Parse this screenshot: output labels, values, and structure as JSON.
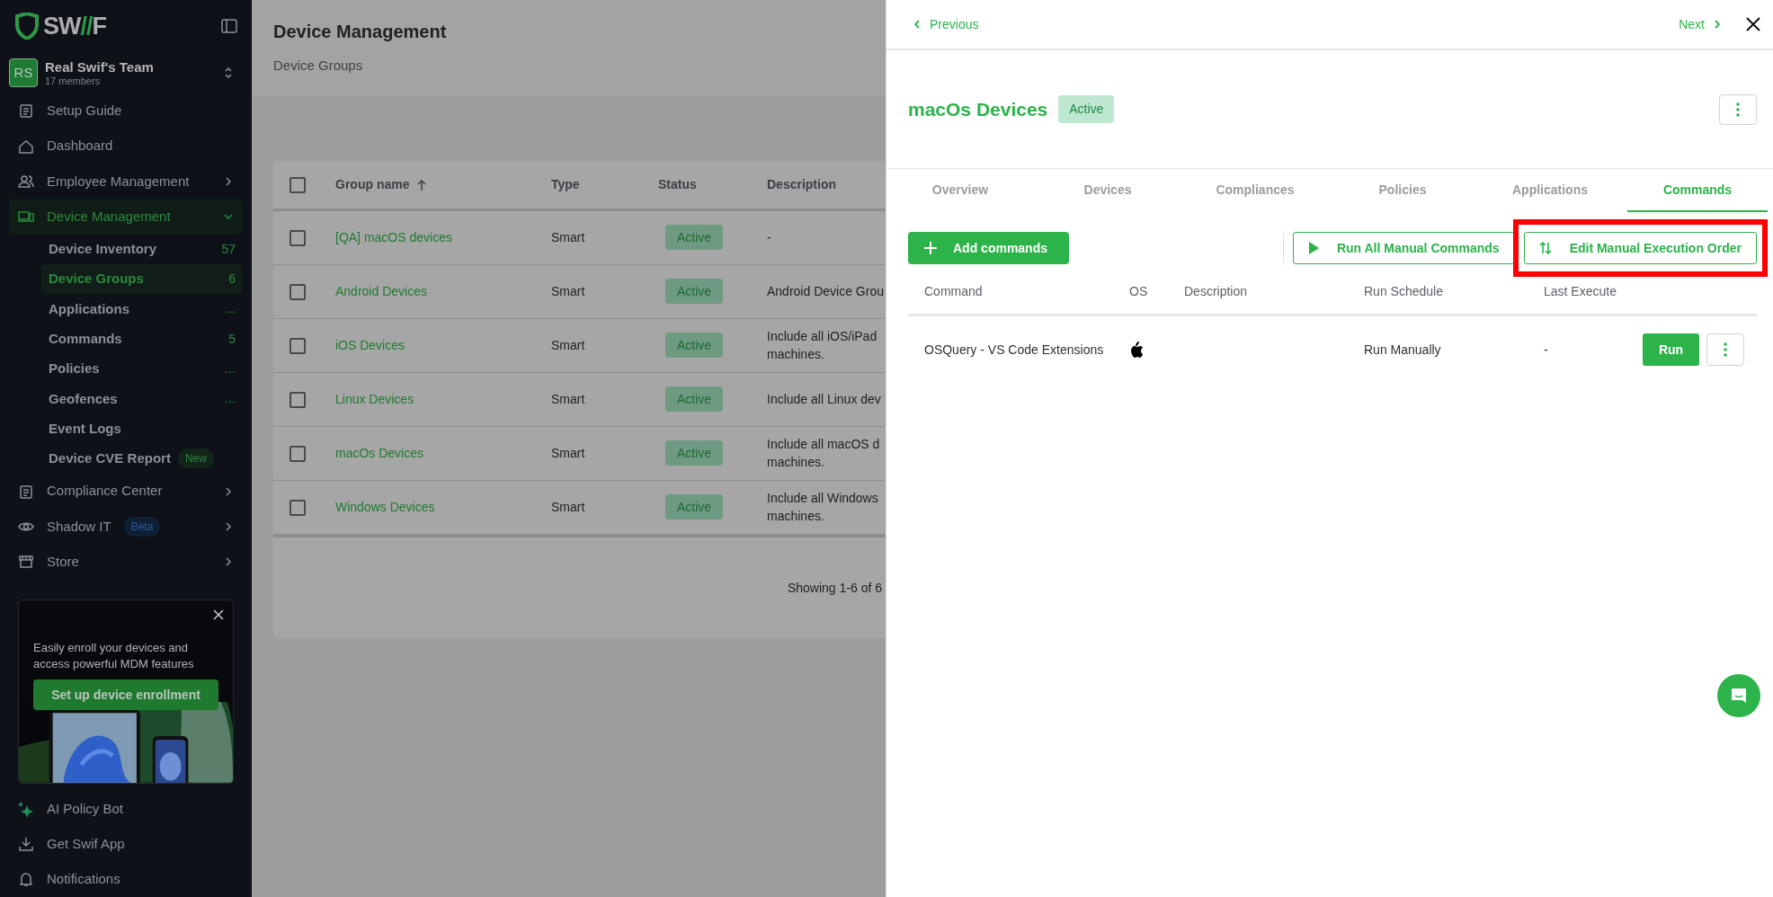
{
  "sidebar": {
    "brand": [
      {
        "text": "SW",
        "accent": false
      },
      {
        "text": "//",
        "accent": true
      },
      {
        "text": "F",
        "accent": false
      }
    ],
    "team": {
      "initials": "RS",
      "name": "Real Swif's Team",
      "members": "17 members"
    },
    "nav": [
      {
        "label": "Setup Guide",
        "selected": false
      },
      {
        "label": "Dashboard",
        "selected": false
      },
      {
        "label": "Employee Management",
        "selected": false,
        "expanded": false
      },
      {
        "label": "Device Management",
        "selected": true,
        "expanded": true,
        "children": [
          {
            "label": "Device Inventory",
            "count": "57",
            "selected": false
          },
          {
            "label": "Device Groups",
            "count": "6",
            "selected": true
          },
          {
            "label": "Applications",
            "count": "...",
            "selected": false
          },
          {
            "label": "Commands",
            "count": "5",
            "selected": false
          },
          {
            "label": "Policies",
            "count": "...",
            "selected": false
          },
          {
            "label": "Geofences",
            "count": "...",
            "selected": false
          },
          {
            "label": "Event Logs",
            "selected": false
          },
          {
            "label": "Device CVE Report",
            "badge": "New",
            "selected": false
          }
        ]
      },
      {
        "label": "Compliance Center",
        "selected": false,
        "expanded": false
      },
      {
        "label": "Shadow IT",
        "badge": "Beta",
        "selected": false,
        "expanded": false
      },
      {
        "label": "Store",
        "selected": false,
        "expanded": false
      }
    ],
    "promo": {
      "text": "Easily enroll your devices and access powerful MDM features",
      "button": "Set up device enrollment"
    },
    "bottom": [
      {
        "label": "AI Policy Bot"
      },
      {
        "label": "Get Swif App"
      },
      {
        "label": "Notifications"
      }
    ]
  },
  "main": {
    "title": "Device Management",
    "subtitle": "Device Groups",
    "table": {
      "header_checked": false,
      "columns": [
        {
          "label": "Group name",
          "sorted": true
        },
        {
          "label": "Type",
          "sorted": false
        },
        {
          "label": "Status",
          "sorted": false
        },
        {
          "label": "Description",
          "sorted": false
        }
      ],
      "rows": [
        {
          "checked": false,
          "name": "[QA] macOS devices",
          "type": "Smart",
          "status": "Active",
          "description": [
            "-"
          ]
        },
        {
          "checked": false,
          "name": "Android Devices",
          "type": "Smart",
          "status": "Active",
          "description": [
            "Android Device Grou"
          ]
        },
        {
          "checked": false,
          "name": "iOS Devices",
          "type": "Smart",
          "status": "Active",
          "description": [
            "Include all iOS/iPad",
            "machines."
          ]
        },
        {
          "checked": false,
          "name": "Linux Devices",
          "type": "Smart",
          "status": "Active",
          "description": [
            "Include all Linux dev"
          ]
        },
        {
          "checked": false,
          "name": "macOs Devices",
          "type": "Smart",
          "status": "Active",
          "description": [
            "Include all macOS d",
            "machines."
          ]
        },
        {
          "checked": false,
          "name": "Windows Devices",
          "type": "Smart",
          "status": "Active",
          "description": [
            "Include all Windows",
            "machines."
          ]
        }
      ],
      "footer": "Showing 1-6 of 6"
    }
  },
  "drawer": {
    "previous": "Previous",
    "next": "Next",
    "title": "macOs Devices",
    "status": "Active",
    "tabs": [
      {
        "label": "Overview",
        "selected": false
      },
      {
        "label": "Devices",
        "selected": false
      },
      {
        "label": "Compliances",
        "selected": false
      },
      {
        "label": "Policies",
        "selected": false
      },
      {
        "label": "Applications",
        "selected": false
      },
      {
        "label": "Commands",
        "selected": true
      }
    ],
    "add_button": "Add commands",
    "actions": [
      {
        "label": "Run All Manual Commands",
        "highlighted": false
      },
      {
        "label": "Edit Manual Execution Order",
        "highlighted": true
      }
    ],
    "columns": [
      "Command",
      "OS",
      "Description",
      "Run Schedule",
      "Last Execute"
    ],
    "rows": [
      {
        "command": "OSQuery - VS Code Extensions",
        "run_schedule": "Run Manually",
        "last_execute": "-",
        "run_button": "Run"
      }
    ]
  }
}
